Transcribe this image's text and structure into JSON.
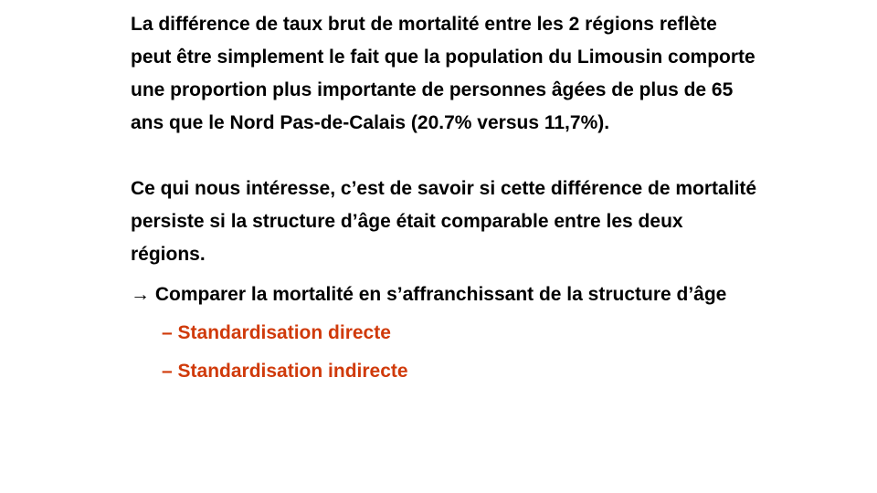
{
  "slide": {
    "paragraph_1": "La différence de taux brut de mortalité entre les 2 régions reflète peut être simplement le fait que la population du Limousin comporte une proportion plus importante de personnes âgées de plus de 65 ans que le Nord Pas-de-Calais (20.7%  versus 11,7%).",
    "paragraph_2": "Ce qui nous intéresse, c’est de savoir si cette différence de mortalité persiste si la structure d’âge était comparable entre les deux régions.",
    "arrow_item": "→ Comparer la mortalité en s’affranchissant de la structure d’âge",
    "sub_items": [
      "– Standardisation directe",
      "– Standardisation indirecte"
    ]
  },
  "colors": {
    "text": "#000000",
    "accent": "#d03a0a",
    "background": "#ffffff"
  }
}
